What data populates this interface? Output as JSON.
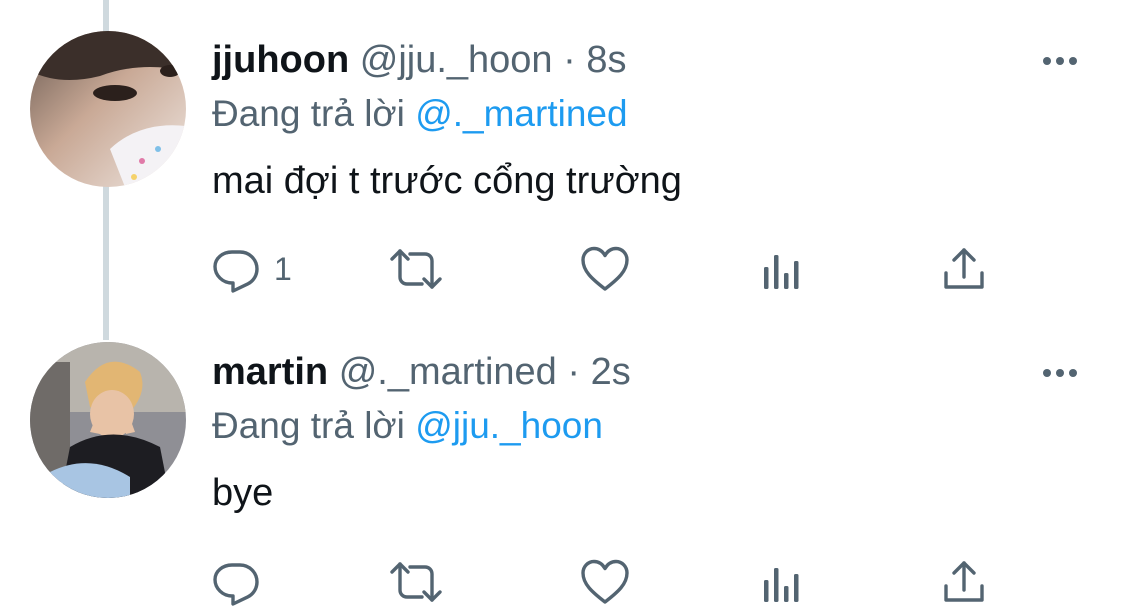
{
  "tweets": [
    {
      "display_name": "jjuhoon",
      "handle": "@jju._hoon",
      "separator": "·",
      "time": "8s",
      "replying_prefix": "Đang trả lời",
      "replying_to": "@._martined",
      "text": "mai đợi t trước cổng trường",
      "reply_count": "1",
      "avatar_icon": "avatar-photo"
    },
    {
      "display_name": "martin",
      "handle": "@._martined",
      "separator": "·",
      "time": "2s",
      "replying_prefix": "Đang trả lời",
      "replying_to": "@jju._hoon",
      "text": "bye",
      "reply_count": "",
      "avatar_icon": "avatar-photo"
    }
  ],
  "icons": {
    "more": "more-dots-icon",
    "reply": "reply-bubble-icon",
    "retweet": "retweet-icon",
    "like": "heart-icon",
    "views": "analytics-icon",
    "share": "share-icon"
  },
  "colors": {
    "text": "#0f1419",
    "secondary": "#536471",
    "link": "#1d9bf0",
    "thread_line": "#cfd9de"
  }
}
